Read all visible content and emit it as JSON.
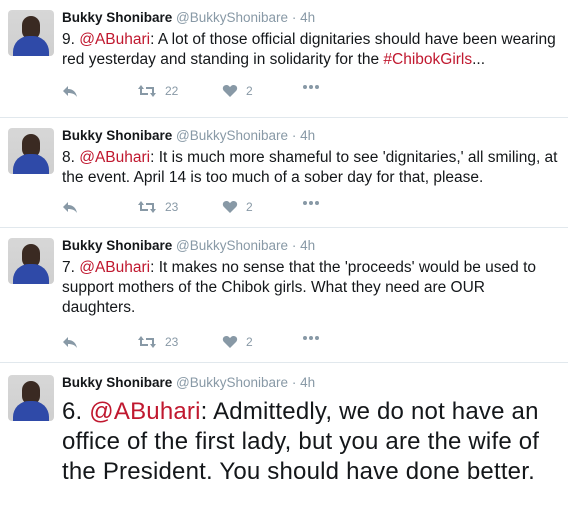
{
  "tweets": [
    {
      "name": "Bukky Shonibare",
      "handle": "@BukkyShonibare",
      "separator": "·",
      "time": "4h",
      "prefix": "9. ",
      "mention": "@ABuhari",
      "text": ": A lot of those official dignitaries should have been wearing red yesterday and standing in solidarity for the ",
      "hashtag": "#ChibokGirls",
      "suffix": "...",
      "retweets": "22",
      "likes": "2"
    },
    {
      "name": "Bukky Shonibare",
      "handle": "@BukkyShonibare",
      "separator": "·",
      "time": "4h",
      "prefix": "8. ",
      "mention": "@ABuhari",
      "text": ": It is much more shameful to see 'dignitaries,' all smiling, at the event. April 14 is too much of a sober day for that, please.",
      "retweets": "23",
      "likes": "2"
    },
    {
      "name": "Bukky Shonibare",
      "handle": "@BukkyShonibare",
      "separator": "·",
      "time": "4h",
      "prefix": "7. ",
      "mention": "@ABuhari",
      "text": ": It makes no sense that the 'proceeds' would be used to support mothers of the Chibok girls. What they need are OUR daughters.",
      "retweets": "23",
      "likes": "2"
    },
    {
      "name": "Bukky Shonibare",
      "handle": "@BukkyShonibare",
      "separator": "·",
      "time": "4h",
      "prefix": "6. ",
      "mention": "@ABuhari",
      "text": ": Admittedly, we do not have an office of the first lady, but you are the wife of the President. You should have done better."
    }
  ],
  "icons": {
    "reply": "reply-icon",
    "retweet": "retweet-icon",
    "like": "heart-icon",
    "more": "more-icon"
  },
  "colors": {
    "link": "#c0182f",
    "muted": "#8899a6"
  }
}
